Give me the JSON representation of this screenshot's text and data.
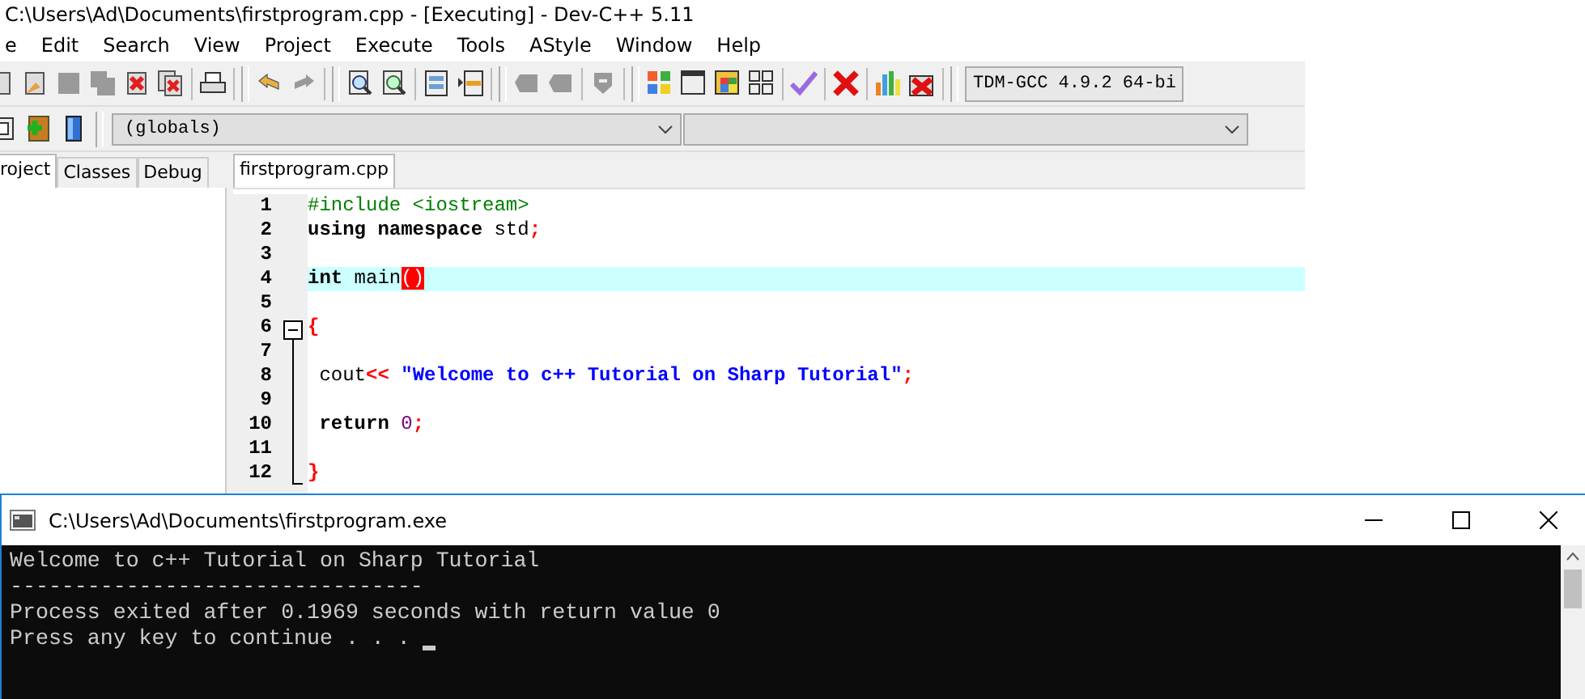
{
  "window": {
    "title": "C:\\Users\\Ad\\Documents\\firstprogram.cpp - [Executing] - Dev-C++ 5.11"
  },
  "menu": [
    "e",
    "Edit",
    "Search",
    "View",
    "Project",
    "Execute",
    "Tools",
    "AStyle",
    "Window",
    "Help"
  ],
  "toolbar": {
    "compiler": "TDM-GCC 4.9.2 64-bi"
  },
  "class_bar": {
    "scope": "(globals)"
  },
  "side_tabs": [
    {
      "label": "roject",
      "selected": true
    },
    {
      "label": "Classes",
      "selected": false
    },
    {
      "label": "Debug",
      "selected": false
    }
  ],
  "editor_tabs": [
    {
      "label": "firstprogram.cpp",
      "selected": true
    }
  ],
  "code": [
    {
      "number": "1",
      "active": false,
      "tokens": [
        {
          "kind": "preprocessor",
          "text": "#include <iostream>"
        }
      ]
    },
    {
      "number": "2",
      "active": false,
      "tokens": [
        {
          "kind": "keyword",
          "text": "using namespace"
        },
        {
          "kind": "plain",
          "text": " std"
        },
        {
          "kind": "symbol",
          "text": ";"
        }
      ]
    },
    {
      "number": "3",
      "active": false
    },
    {
      "number": "4",
      "active": true,
      "tokens": [
        {
          "kind": "keyword",
          "text": "int"
        },
        {
          "kind": "plain",
          "text": " main"
        },
        {
          "kind": "brace-match",
          "text": "()"
        }
      ]
    },
    {
      "number": "5",
      "active": false
    },
    {
      "number": "6",
      "active": false,
      "tokens": [
        {
          "kind": "symbol",
          "text": "{"
        }
      ]
    },
    {
      "number": "7",
      "active": false
    },
    {
      "number": "8",
      "active": false,
      "tokens": [
        {
          "kind": "plain",
          "text": " cout"
        },
        {
          "kind": "symbol",
          "text": "<<"
        },
        {
          "kind": "string",
          "text": " \"Welcome to c++ Tutorial on Sharp Tutorial\""
        },
        {
          "kind": "symbol",
          "text": ";"
        }
      ]
    },
    {
      "number": "9",
      "active": false
    },
    {
      "number": "10",
      "active": false,
      "tokens": [
        {
          "kind": "keyword",
          "text": " return"
        },
        {
          "kind": "number",
          "text": " 0"
        },
        {
          "kind": "symbol",
          "text": ";"
        }
      ]
    },
    {
      "number": "11",
      "active": false
    },
    {
      "number": "12",
      "active": false,
      "tokens": [
        {
          "kind": "symbol",
          "text": "}"
        }
      ]
    }
  ],
  "console": {
    "title": "C:\\Users\\Ad\\Documents\\firstprogram.exe",
    "lines": [
      "Welcome to c++ Tutorial on Sharp Tutorial",
      "--------------------------------",
      "Process exited after 0.1969 seconds with return value 0",
      "Press any key to continue . . . "
    ]
  }
}
